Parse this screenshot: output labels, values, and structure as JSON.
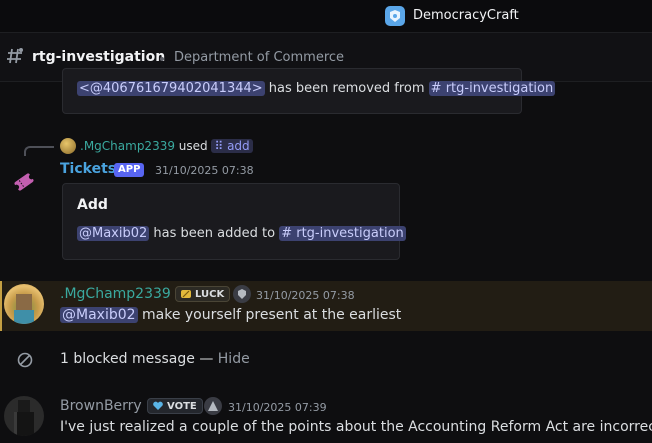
{
  "server": {
    "name": "DemocracyCraft",
    "icon": "server-logo-icon"
  },
  "channel": {
    "name": "rtg-investigation",
    "topic": "Department of Commerce"
  },
  "previous_embed": {
    "mention": "<@406761679402041344>",
    "text": " has been removed from ",
    "channel_mention": "# rtg-investigation"
  },
  "reply": {
    "user": ".MgChamp2339",
    "used": " used ",
    "command": "add"
  },
  "tickets_message": {
    "author": "Tickets",
    "badge": "APP",
    "timestamp": "31/10/2025 07:38",
    "embed": {
      "title": "Add",
      "mention": "@Maxib02",
      "text": " has been added to ",
      "channel_mention": "# rtg-investigation"
    }
  },
  "mg_message": {
    "author": ".MgChamp2339",
    "badge": "LUCK",
    "timestamp": "31/10/2025 07:38",
    "mention": "@Maxib02",
    "text": " make yourself present at the earliest"
  },
  "blocked": {
    "text": "1 blocked message — ",
    "hide": "Hide"
  },
  "bb_message": {
    "author": "BrownBerry",
    "badge": "VOTE",
    "timestamp": "31/10/2025 07:39",
    "text": "I've just realized a couple of the points about the Accounting Reform Act are incorrect"
  },
  "colors": {
    "accent": "#5865f2",
    "highlight_border": "#c5a043",
    "username_teal": "#3aa99f",
    "tickets_blue": "#4aa3df"
  }
}
